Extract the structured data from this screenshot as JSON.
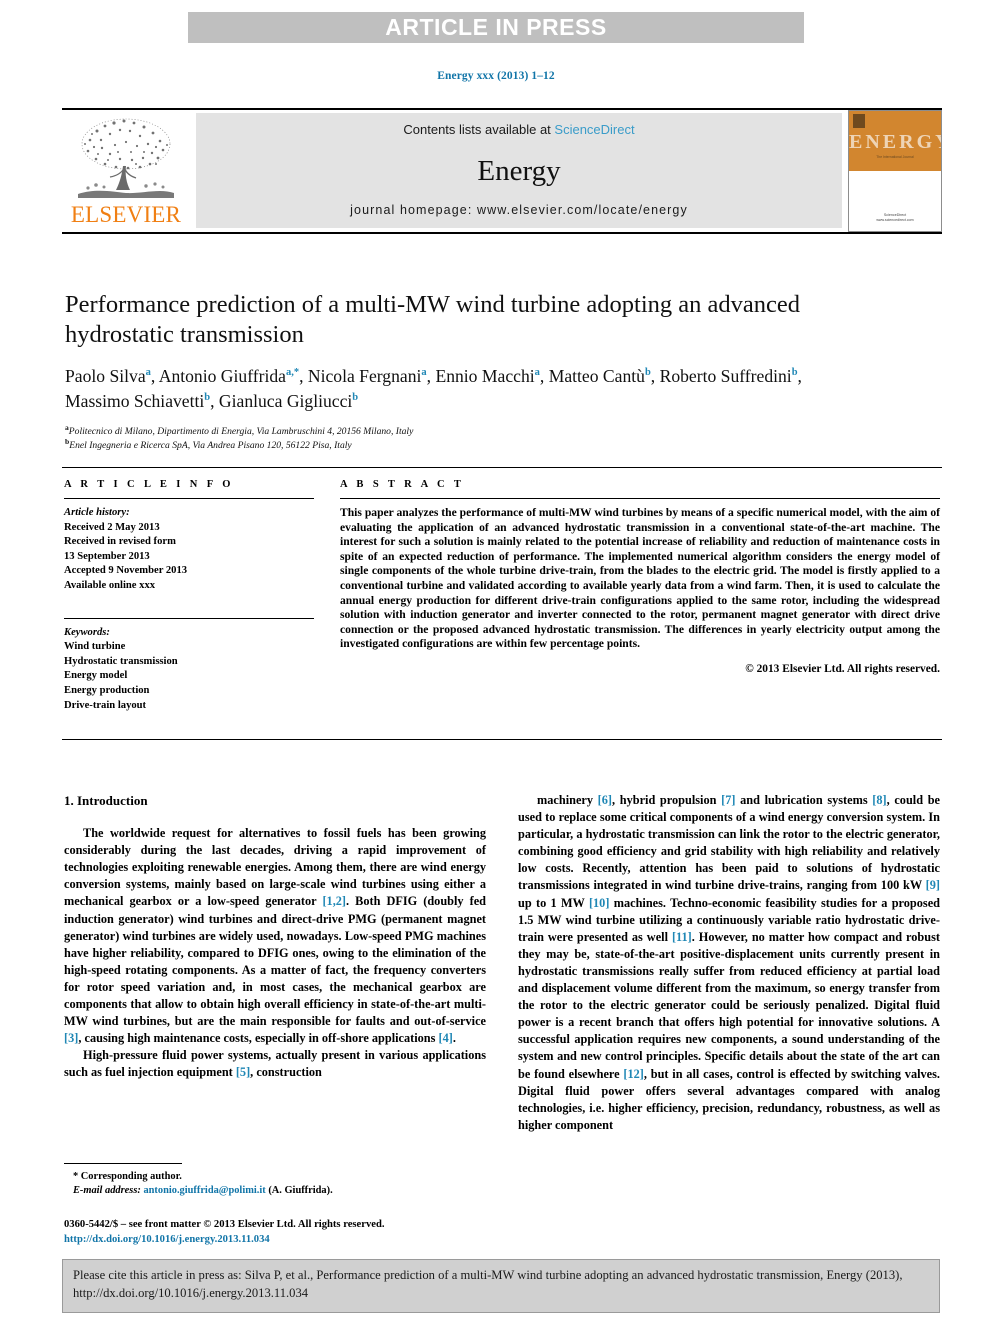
{
  "banner": {
    "text": "ARTICLE IN PRESS"
  },
  "running_head": "Energy xxx (2013) 1–12",
  "masthead": {
    "contents_prefix": "Contents lists available at ",
    "sciencedirect": "ScienceDirect",
    "journal_name": "Energy",
    "homepage": "journal homepage: www.elsevier.com/locate/energy",
    "publisher": "ELSEVIER",
    "cover_title": "ENERGY",
    "cover_caption": "The International Journal",
    "cover_publisher": "ScienceDirect",
    "cover_publisher_sub": "www.sciencedirect.com"
  },
  "title": "Performance prediction of a multi-MW wind turbine adopting an advanced hydrostatic transmission",
  "authors_html": "Paolo Silva<sup>a</sup>, Antonio Giuffrida<sup>a,*</sup>, Nicola Fergnani<sup>a</sup>, Ennio Macchi<sup>a</sup>, Matteo Cantù<sup>b</sup>, Roberto Suffredini<sup>b</sup>, Massimo Schiavetti<sup>b</sup>, Gianluca Gigliucci<sup>b</sup>",
  "affiliations_html": "<sup>a</sup>Politecnico di Milano, Dipartimento di Energia, Via Lambruschini 4, 20156 Milano, Italy<br><sup>b</sup>Enel Ingegneria e Ricerca SpA, Via Andrea Pisano 120, 56122 Pisa, Italy",
  "article_info": {
    "heading": "A R T I C L E   I N F O",
    "history_label": "Article history:",
    "history": [
      "Received 2 May 2013",
      "Received in revised form",
      "13 September 2013",
      "Accepted 9 November 2013",
      "Available online xxx"
    ],
    "keywords_label": "Keywords:",
    "keywords": [
      "Wind turbine",
      "Hydrostatic transmission",
      "Energy model",
      "Energy production",
      "Drive-train layout"
    ]
  },
  "abstract": {
    "heading": "A B S T R A C T",
    "text": "This paper analyzes the performance of multi-MW wind turbines by means of a specific numerical model, with the aim of evaluating the application of an advanced hydrostatic transmission in a conventional state-of-the-art machine. The interest for such a solution is mainly related to the potential increase of reliability and reduction of maintenance costs in spite of an expected reduction of performance. The implemented numerical algorithm considers the energy model of single components of the whole turbine drive-train, from the blades to the electric grid. The model is firstly applied to a conventional turbine and validated according to available yearly data from a wind farm. Then, it is used to calculate the annual energy production for different drive-train configurations applied to the same rotor, including the widespread solution with induction generator and inverter connected to the rotor, permanent magnet generator with direct drive connection or the proposed advanced hydrostatic transmission. The differences in yearly electricity output among the investigated configurations are within few percentage points.",
    "copyright": "© 2013 Elsevier Ltd. All rights reserved."
  },
  "body": {
    "section_title": "1. Introduction",
    "left_paragraphs_html": [
      "The worldwide request for alternatives to fossil fuels has been growing considerably during the last decades, driving a rapid improvement of technologies exploiting renewable energies. Among them, there are wind energy conversion systems, mainly based on large-scale wind turbines using either a mechanical gearbox or a low-speed generator <span class=\"ref\">[1,2]</span>. Both DFIG (doubly fed induction generator) wind turbines and direct-drive PMG (permanent magnet generator) wind turbines are widely used, nowadays. Low-speed PMG machines have higher reliability, compared to DFIG ones, owing to the elimination of the high-speed rotating components. As a matter of fact, the frequency converters for rotor speed variation and, in most cases, the mechanical gearbox are components that allow to obtain high overall efficiency in state-of-the-art multi-MW wind turbines, but are the main responsible for faults and out-of-service <span class=\"ref\">[3]</span>, causing high maintenance costs, especially in off-shore applications <span class=\"ref\">[4]</span>.",
      "High-pressure fluid power systems, actually present in various applications such as fuel injection equipment <span class=\"ref\">[5]</span>, construction"
    ],
    "right_paragraphs_html": [
      "machinery <span class=\"ref\">[6]</span>, hybrid propulsion <span class=\"ref\">[7]</span> and lubrication systems <span class=\"ref\">[8]</span>, could be used to replace some critical components of a wind energy conversion system. In particular, a hydrostatic transmission can link the rotor to the electric generator, combining good efficiency and grid stability with high reliability and relatively low costs. Recently, attention has been paid to solutions of hydrostatic transmissions integrated in wind turbine drive-trains, ranging from 100 kW <span class=\"ref\">[9]</span> up to 1 MW <span class=\"ref\">[10]</span> machines. Techno-economic feasibility studies for a proposed 1.5 MW wind turbine utilizing a continuously variable ratio hydrostatic drive-train were presented as well <span class=\"ref\">[11]</span>. However, no matter how compact and robust they may be, state-of-the-art positive-displacement units currently present in hydrostatic transmissions really suffer from reduced efficiency at partial load and displacement volume different from the maximum, so energy transfer from the rotor to the electric generator could be seriously penalized. Digital fluid power is a recent branch that offers high potential for innovative solutions. A successful application requires new components, a sound understanding of the system and new control principles. Specific details about the state of the art can be found elsewhere <span class=\"ref\">[12]</span>, but in all cases, control is effected by switching valves. Digital fluid power offers several advantages compared with analog technologies, i.e. higher efficiency, precision, redundancy, robustness, as well as higher component"
    ]
  },
  "footnote": {
    "corresponding": "* Corresponding author.",
    "email_label": "E-mail address:",
    "email": "antonio.giuffrida@polimi.it",
    "email_suffix": "(A. Giuffrida).",
    "frontmatter": "0360-5442/$ – see front matter © 2013 Elsevier Ltd. All rights reserved.",
    "doi": "http://dx.doi.org/10.1016/j.energy.2013.11.034"
  },
  "cite_box": {
    "text": "Please cite this article in press as: Silva P, et al., Performance prediction of a multi-MW wind turbine adopting an advanced hydrostatic transmission, Energy (2013), http://dx.doi.org/10.1016/j.energy.2013.11.034"
  },
  "colors": {
    "link_blue": "#1175a8",
    "ref_blue": "#1f87b5",
    "sciencedirect_blue": "#3a9cc9",
    "elsevier_orange": "#f07f13",
    "banner_gray": "#bfbfbf",
    "masthead_gray": "#e3e3e3",
    "cite_gray": "#d0d0d0"
  }
}
